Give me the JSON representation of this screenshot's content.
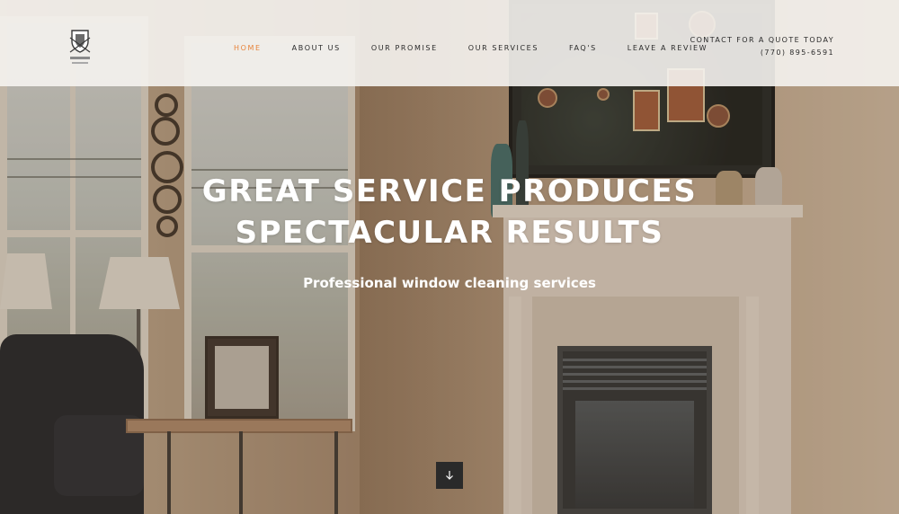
{
  "header": {
    "logo_alt": "Company shield logo",
    "nav": [
      {
        "label": "HOME",
        "active": true
      },
      {
        "label": "ABOUT US",
        "active": false
      },
      {
        "label": "OUR PROMISE",
        "active": false
      },
      {
        "label": "OUR SERVICES",
        "active": false
      },
      {
        "label": "FAQ'S",
        "active": false
      },
      {
        "label": "LEAVE A REVIEW",
        "active": false
      }
    ],
    "contact_label": "CONTACT FOR A QUOTE TODAY",
    "contact_phone": "(770) 895-6591"
  },
  "hero": {
    "title_line1": "GREAT SERVICE PRODUCES",
    "title_line2": "SPECTACULAR RESULTS",
    "subtitle": "Professional window cleaning services",
    "scroll_icon": "arrow-down-icon"
  },
  "colors": {
    "accent": "#e8843b",
    "header_bg": "#f5f3f0",
    "scroll_button_bg": "#2a2a2a"
  }
}
